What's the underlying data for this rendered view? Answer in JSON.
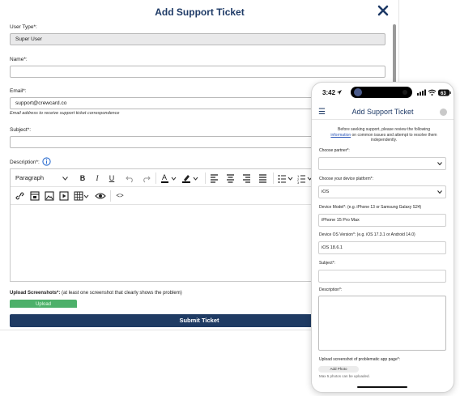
{
  "desktop": {
    "title": "Add Support Ticket",
    "user_type_label": "User Type*:",
    "user_type_value": "Super User",
    "name_label": "Name*:",
    "name_value": "",
    "email_label": "Email*:",
    "email_value": "support@crewcard.co",
    "email_help": "Email address to receive support ticket correspondence",
    "subject_label": "Subject*:",
    "subject_value": "",
    "description_label": "Description*:",
    "editor": {
      "paragraph_select": "Paragraph",
      "bold": "B",
      "italic": "I",
      "underline": "U",
      "code_label": "<>"
    },
    "upload_label_bold": "Upload Screenshots*:",
    "upload_label_rest": " (at least one screenshot that clearly shows the problem)",
    "upload_button": "Upload",
    "submit_button": "Submit Ticket"
  },
  "phone": {
    "time": "3:42",
    "battery": "63",
    "title": "Add Support Ticket",
    "menu_icon": "☰",
    "intro_before": "Before seeking support, please review the following",
    "intro_link": "information",
    "intro_after": " on common issues and attempt to resolve them independently.",
    "partner_label": "Choose partner*:",
    "partner_value": "",
    "platform_label": "Choose your device platform*:",
    "platform_value": "iOS",
    "model_label": "Device Model*: (e.g. iPhone 13 or Samsung Galaxy S24)",
    "model_value": "iPhone 15 Pro Max",
    "os_label": "Device OS Version*: (e.g. iOS 17.3.1 or Android 14.0)",
    "os_value": "iOS 18.6.1",
    "subject_label": "Subject*:",
    "subject_value": "",
    "description_label": "Description*:",
    "upload_label": "Upload screenshot of problematic app page*:",
    "add_photo": "Add Photo",
    "max_note": "Max 5 photos can be uploaded."
  },
  "colors": {
    "title": "#1e3a66",
    "submit": "#1f3b63",
    "upload": "#4db06a",
    "link": "#2c57b8"
  }
}
